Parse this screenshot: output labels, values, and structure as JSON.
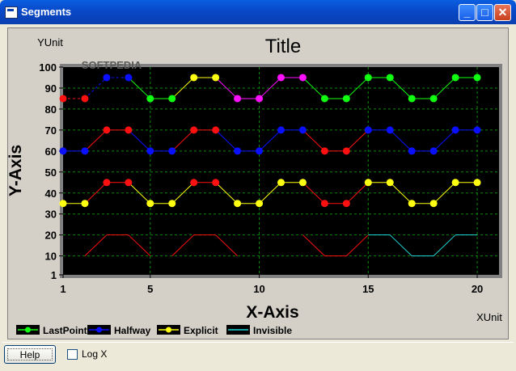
{
  "window": {
    "title": "Segments",
    "btn_min": "_",
    "btn_max": "□",
    "btn_close": "✕"
  },
  "footer": {
    "help_label": "Help",
    "logx_label": "Log X"
  },
  "watermark": "SOFTPEDIA",
  "colors": {
    "plot_bg": "#000000",
    "grid": "#0a8a0a",
    "red": "#ff1010",
    "blue": "#0a10ff",
    "yellow": "#ffff10",
    "magenta": "#ff10ff",
    "green": "#10ff10",
    "cyan": "#20d8d8",
    "frame": "#d4d0c8"
  },
  "chart_data": {
    "type": "line",
    "title": "Title",
    "xlabel": "X-Axis",
    "ylabel": "Y-Axis",
    "x_unit": "XUnit",
    "y_unit": "YUnit",
    "xlim": [
      1,
      21
    ],
    "ylim": [
      1,
      100
    ],
    "xticks": [
      1,
      5,
      10,
      15,
      20
    ],
    "yticks": [
      1,
      10,
      20,
      30,
      40,
      50,
      60,
      70,
      80,
      90,
      100
    ],
    "grid": true,
    "legend_position": "bottom-left",
    "legend": [
      {
        "name": "LastPoint",
        "line": "green",
        "marker": "green"
      },
      {
        "name": "Halfway",
        "line": "blue",
        "marker": "blue"
      },
      {
        "name": "Explicit",
        "line": "yellow",
        "marker": "yellow"
      },
      {
        "name": "Invisible",
        "line": "cyan",
        "marker": "none"
      }
    ],
    "series": [
      {
        "x": [
          1,
          2,
          3,
          4,
          5,
          6,
          7,
          8,
          9,
          10,
          11,
          12,
          13,
          14,
          15,
          16,
          17,
          18,
          19,
          20
        ],
        "y": [
          85,
          85,
          95,
          95,
          85,
          85,
          95,
          95,
          85,
          85,
          95,
          95,
          85,
          85,
          95,
          95,
          85,
          85,
          95,
          95
        ],
        "seg_colors": [
          "red",
          "blue",
          "blue",
          "green",
          "green",
          "yellow",
          "yellow",
          "magenta",
          "magenta",
          "magenta",
          "magenta",
          "green",
          "green",
          "green",
          "green",
          "green",
          "green",
          "green",
          "green"
        ],
        "pt_colors": [
          "red",
          "red",
          "blue",
          "blue",
          "green",
          "green",
          "yellow",
          "yellow",
          "magenta",
          "magenta",
          "magenta",
          "magenta",
          "green",
          "green",
          "green",
          "green",
          "green",
          "green",
          "green",
          "green"
        ],
        "dashed_segments": [
          0,
          1,
          2
        ],
        "markers": true
      },
      {
        "x": [
          1,
          2,
          3,
          4,
          5,
          6,
          7,
          8,
          9,
          10,
          11,
          12,
          13,
          14,
          15,
          16,
          17,
          18,
          19,
          20
        ],
        "y": [
          60,
          60,
          70,
          70,
          60,
          60,
          70,
          70,
          60,
          60,
          70,
          70,
          60,
          60,
          70,
          70,
          60,
          60,
          70,
          70
        ],
        "seg_colors": [
          "blue",
          "red",
          "red",
          "blue",
          "blue",
          "red",
          "red",
          "blue",
          "blue",
          "blue",
          "blue",
          "red",
          "red",
          "red",
          "blue",
          "blue",
          "blue",
          "blue",
          "blue"
        ],
        "pt_colors": [
          "blue",
          "blue",
          "red",
          "red",
          "blue",
          "blue",
          "red",
          "red",
          "blue",
          "blue",
          "blue",
          "blue",
          "red",
          "red",
          "blue",
          "blue",
          "blue",
          "blue",
          "blue",
          "blue"
        ],
        "markers": true
      },
      {
        "x": [
          1,
          2,
          3,
          4,
          5,
          6,
          7,
          8,
          9,
          10,
          11,
          12,
          13,
          14,
          15,
          16,
          17,
          18,
          19,
          20
        ],
        "y": [
          35,
          35,
          45,
          45,
          35,
          35,
          45,
          45,
          35,
          35,
          45,
          45,
          35,
          35,
          45,
          45,
          35,
          35,
          45,
          45
        ],
        "seg_colors": [
          "yellow",
          "red",
          "red",
          "yellow",
          "yellow",
          "yellow",
          "red",
          "yellow",
          "yellow",
          "yellow",
          "yellow",
          "red",
          "red",
          "red",
          "yellow",
          "yellow",
          "yellow",
          "yellow",
          "yellow"
        ],
        "pt_colors": [
          "yellow",
          "yellow",
          "red",
          "red",
          "yellow",
          "yellow",
          "red",
          "red",
          "yellow",
          "yellow",
          "yellow",
          "yellow",
          "red",
          "red",
          "yellow",
          "yellow",
          "yellow",
          "yellow",
          "yellow",
          "yellow"
        ],
        "markers": true
      },
      {
        "x": [
          1,
          2,
          3,
          4,
          5,
          6,
          7,
          8,
          9,
          10,
          11,
          12,
          13,
          14,
          15,
          16,
          17,
          18,
          19,
          20
        ],
        "y": [
          10,
          10,
          20,
          20,
          10,
          10,
          20,
          20,
          10,
          10,
          20,
          20,
          10,
          10,
          20,
          20,
          10,
          10,
          20,
          20
        ],
        "seg_colors": [
          "none",
          "red",
          "red",
          "red",
          "none",
          "red",
          "red",
          "red",
          "none",
          "none",
          "none",
          "red",
          "red",
          "red",
          "cyan",
          "cyan",
          "cyan",
          "cyan",
          "cyan"
        ],
        "markers": false
      }
    ]
  }
}
